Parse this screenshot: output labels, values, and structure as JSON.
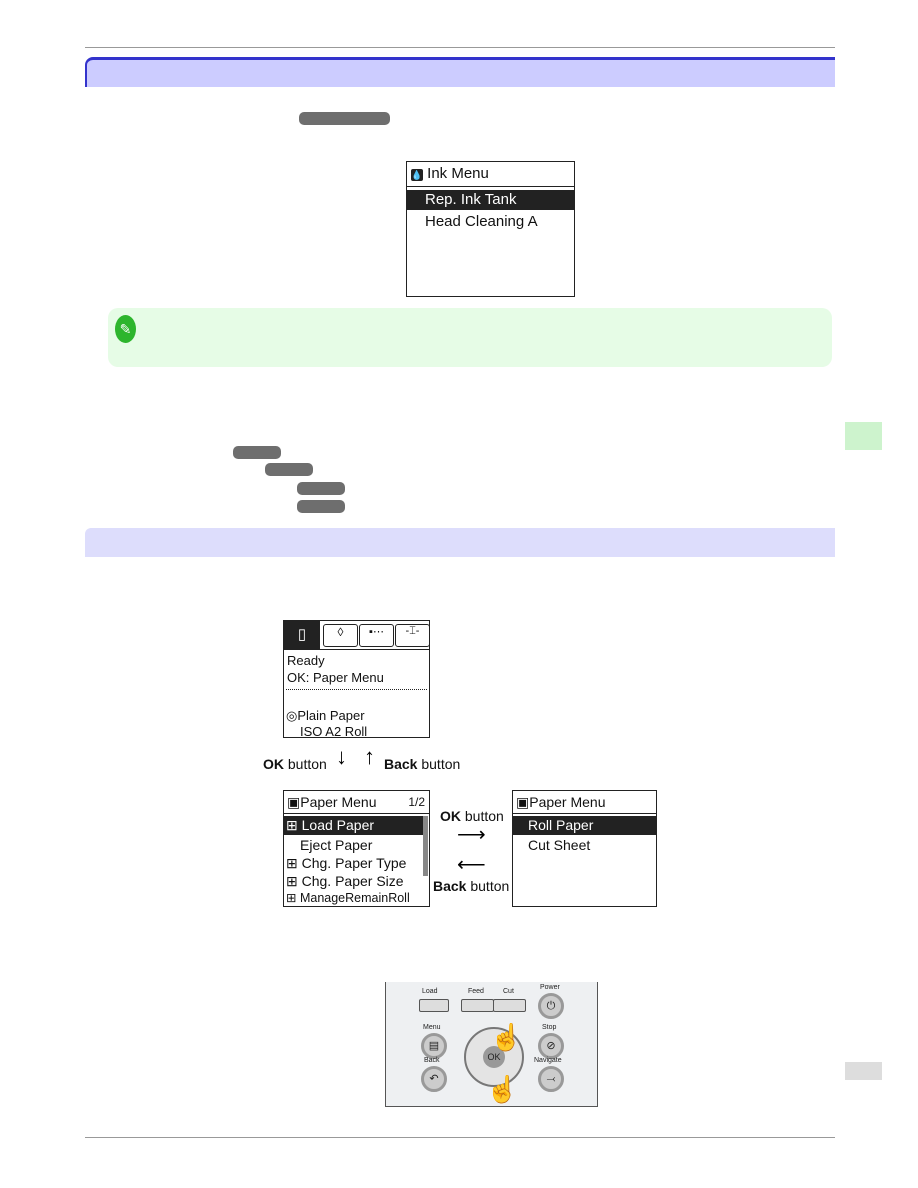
{
  "ink_menu": {
    "title": "Ink Menu",
    "items": [
      "Rep. Ink Tank",
      "Head Cleaning A"
    ],
    "selected": 0
  },
  "tab_screen": {
    "tabs": [
      "paper-icon",
      "ink-drop-icon",
      "job-icon",
      "settings-icon"
    ],
    "status": "Ready",
    "hint": "OK: Paper Menu",
    "paper_type": "Plain Paper",
    "paper_size": "ISO A2 Roll"
  },
  "arrows": {
    "ok_bold": "OK",
    "back_bold": "Back",
    "button_word": " button"
  },
  "paper_menu": {
    "title": "Paper Menu",
    "page": "1/2",
    "items": [
      {
        "label": "Load Paper",
        "expand": true
      },
      {
        "label": "Eject Paper",
        "expand": false
      },
      {
        "label": "Chg. Paper Type",
        "expand": true
      },
      {
        "label": "Chg. Paper Size",
        "expand": true
      },
      {
        "label": "ManageRemainRoll",
        "expand": true
      }
    ],
    "selected": 0
  },
  "load_menu": {
    "title": "Paper Menu",
    "items": [
      "Roll Paper",
      "Cut Sheet"
    ],
    "selected": 0
  },
  "control_panel": {
    "load": "Load",
    "feed": "Feed",
    "cut": "Cut",
    "power": "Power",
    "menu": "Menu",
    "stop": "Stop",
    "back": "Back",
    "navigate": "Navigate",
    "ok": "OK"
  },
  "colors": {
    "heading_bar": "#ccccff",
    "heading_border": "#3333cc",
    "note_bg": "#e6fce6",
    "side_tab": "#cdf3cd",
    "pill": "#6e6e6e"
  }
}
